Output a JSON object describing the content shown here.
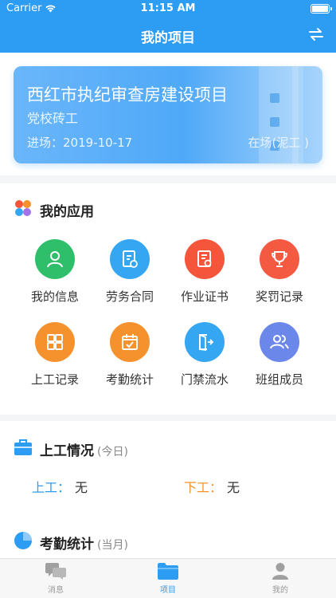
{
  "status_bar": {
    "carrier": "Carrier",
    "time": "11:15 AM"
  },
  "nav": {
    "title": "我的项目",
    "swap_icon": "swap-icon"
  },
  "project": {
    "name": "西红市执纪审查房建设项目",
    "role": "党校砖工",
    "date_label": "进场：",
    "date": "2019-10-17",
    "status": "在场(泥工 )"
  },
  "apps": {
    "title": "我的应用",
    "items": [
      {
        "label": "我的信息",
        "icon": "user-icon",
        "color": "#2fbf6a"
      },
      {
        "label": "劳务合同",
        "icon": "contract-icon",
        "color": "#35a6f2"
      },
      {
        "label": "作业证书",
        "icon": "certificate-icon",
        "color": "#f4553b"
      },
      {
        "label": "奖罚记录",
        "icon": "trophy-icon",
        "color": "#f45a42"
      },
      {
        "label": "上工记录",
        "icon": "grid-icon",
        "color": "#f6922e"
      },
      {
        "label": "考勤统计",
        "icon": "calendar-icon",
        "color": "#f6922e"
      },
      {
        "label": "门禁流水",
        "icon": "door-icon",
        "color": "#35a6f2"
      },
      {
        "label": "班组成员",
        "icon": "team-icon",
        "color": "#6b87ea"
      }
    ]
  },
  "work": {
    "title": "上工情况",
    "period": "(今日)",
    "on_label": "上工：",
    "on_value": "无",
    "off_label": "下工：",
    "off_value": "无",
    "on_color": "#2d9cf3",
    "off_color": "#f6922e"
  },
  "attendance": {
    "title": "考勤统计",
    "period": "(当月)"
  },
  "tabs": [
    {
      "label": "消息",
      "icon": "message-icon"
    },
    {
      "label": "项目",
      "icon": "folder-icon"
    },
    {
      "label": "我的",
      "icon": "person-icon"
    }
  ]
}
